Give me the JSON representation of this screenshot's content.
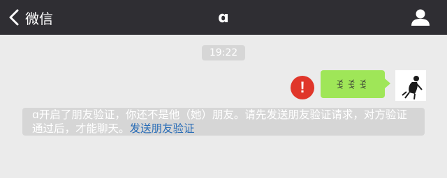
{
  "header": {
    "back_label": "微信",
    "title": "ɑ"
  },
  "chat": {
    "timestamp": "19:22",
    "sent_message": "ꉂꉂꉂ",
    "send_failed_icon": "exclamation-icon",
    "system_notice": {
      "text": "ɑ开启了朋友验证，你还不是他（她）朋友。请先发送朋友验证请求，对方验证通过后，才能聊天。",
      "link": "发送朋友验证"
    }
  },
  "colors": {
    "header_bg": "#2f2e33",
    "chat_bg": "#ebebeb",
    "bubble": "#9fe658",
    "error": "#e0362a",
    "link": "#2a6db7"
  }
}
